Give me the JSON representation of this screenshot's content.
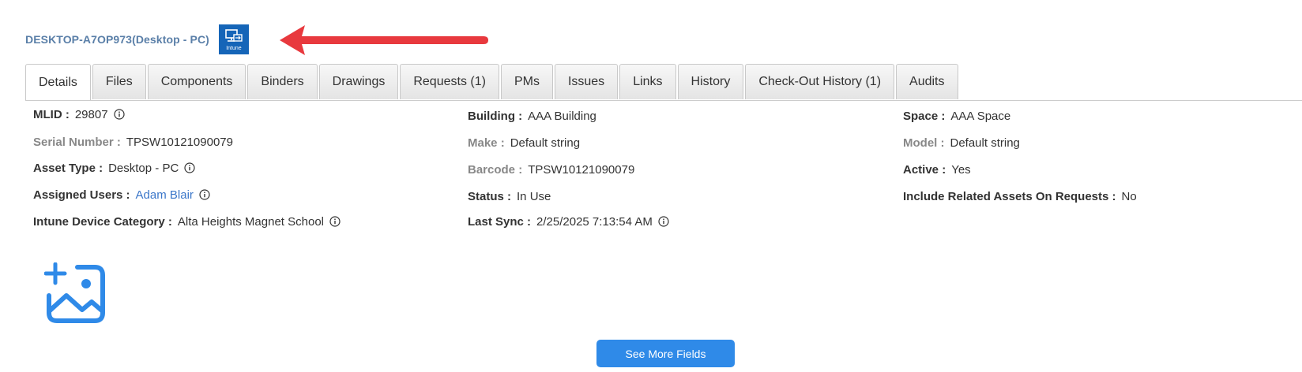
{
  "asset": {
    "title": "DESKTOP-A7OP973(Desktop - PC)",
    "badge_label": "Intune"
  },
  "tabs": [
    {
      "label": "Details",
      "active": true
    },
    {
      "label": "Files"
    },
    {
      "label": "Components"
    },
    {
      "label": "Binders"
    },
    {
      "label": "Drawings"
    },
    {
      "label": "Requests (1)"
    },
    {
      "label": "PMs"
    },
    {
      "label": "Issues"
    },
    {
      "label": "Links"
    },
    {
      "label": "History"
    },
    {
      "label": "Check-Out History (1)"
    },
    {
      "label": "Audits"
    }
  ],
  "details": {
    "mlid": {
      "label": "MLID :",
      "value": "29807"
    },
    "serial": {
      "label": "Serial Number :",
      "value": "TPSW10121090079"
    },
    "asset_type": {
      "label": "Asset Type :",
      "value": "Desktop - PC"
    },
    "assigned_users": {
      "label": "Assigned Users :",
      "value": "Adam Blair"
    },
    "intune_category": {
      "label": "Intune Device Category :",
      "value": "Alta Heights Magnet School"
    },
    "building": {
      "label": "Building :",
      "value": "AAA Building"
    },
    "make": {
      "label": "Make :",
      "value": "Default string"
    },
    "barcode": {
      "label": "Barcode :",
      "value": "TPSW10121090079"
    },
    "status": {
      "label": "Status :",
      "value": "In Use"
    },
    "last_sync": {
      "label": "Last Sync :",
      "value": "2/25/2025 7:13:54 AM"
    },
    "space": {
      "label": "Space :",
      "value": "AAA Space"
    },
    "model": {
      "label": "Model :",
      "value": "Default string"
    },
    "active": {
      "label": "Active :",
      "value": "Yes"
    },
    "include_related": {
      "label": "Include Related Assets On Requests :",
      "value": "No"
    }
  },
  "actions": {
    "see_more_label": "See More Fields"
  },
  "colors": {
    "title": "#5a7fa8",
    "badge": "#1565b8",
    "link": "#3a76c9",
    "button": "#2f8ae8",
    "arrow": "#e8393e"
  },
  "icons": {
    "intune": "computer-sync-icon",
    "info": "info-circle-icon",
    "add_image": "add-image-icon",
    "arrow": "red-arrow-annotation"
  }
}
